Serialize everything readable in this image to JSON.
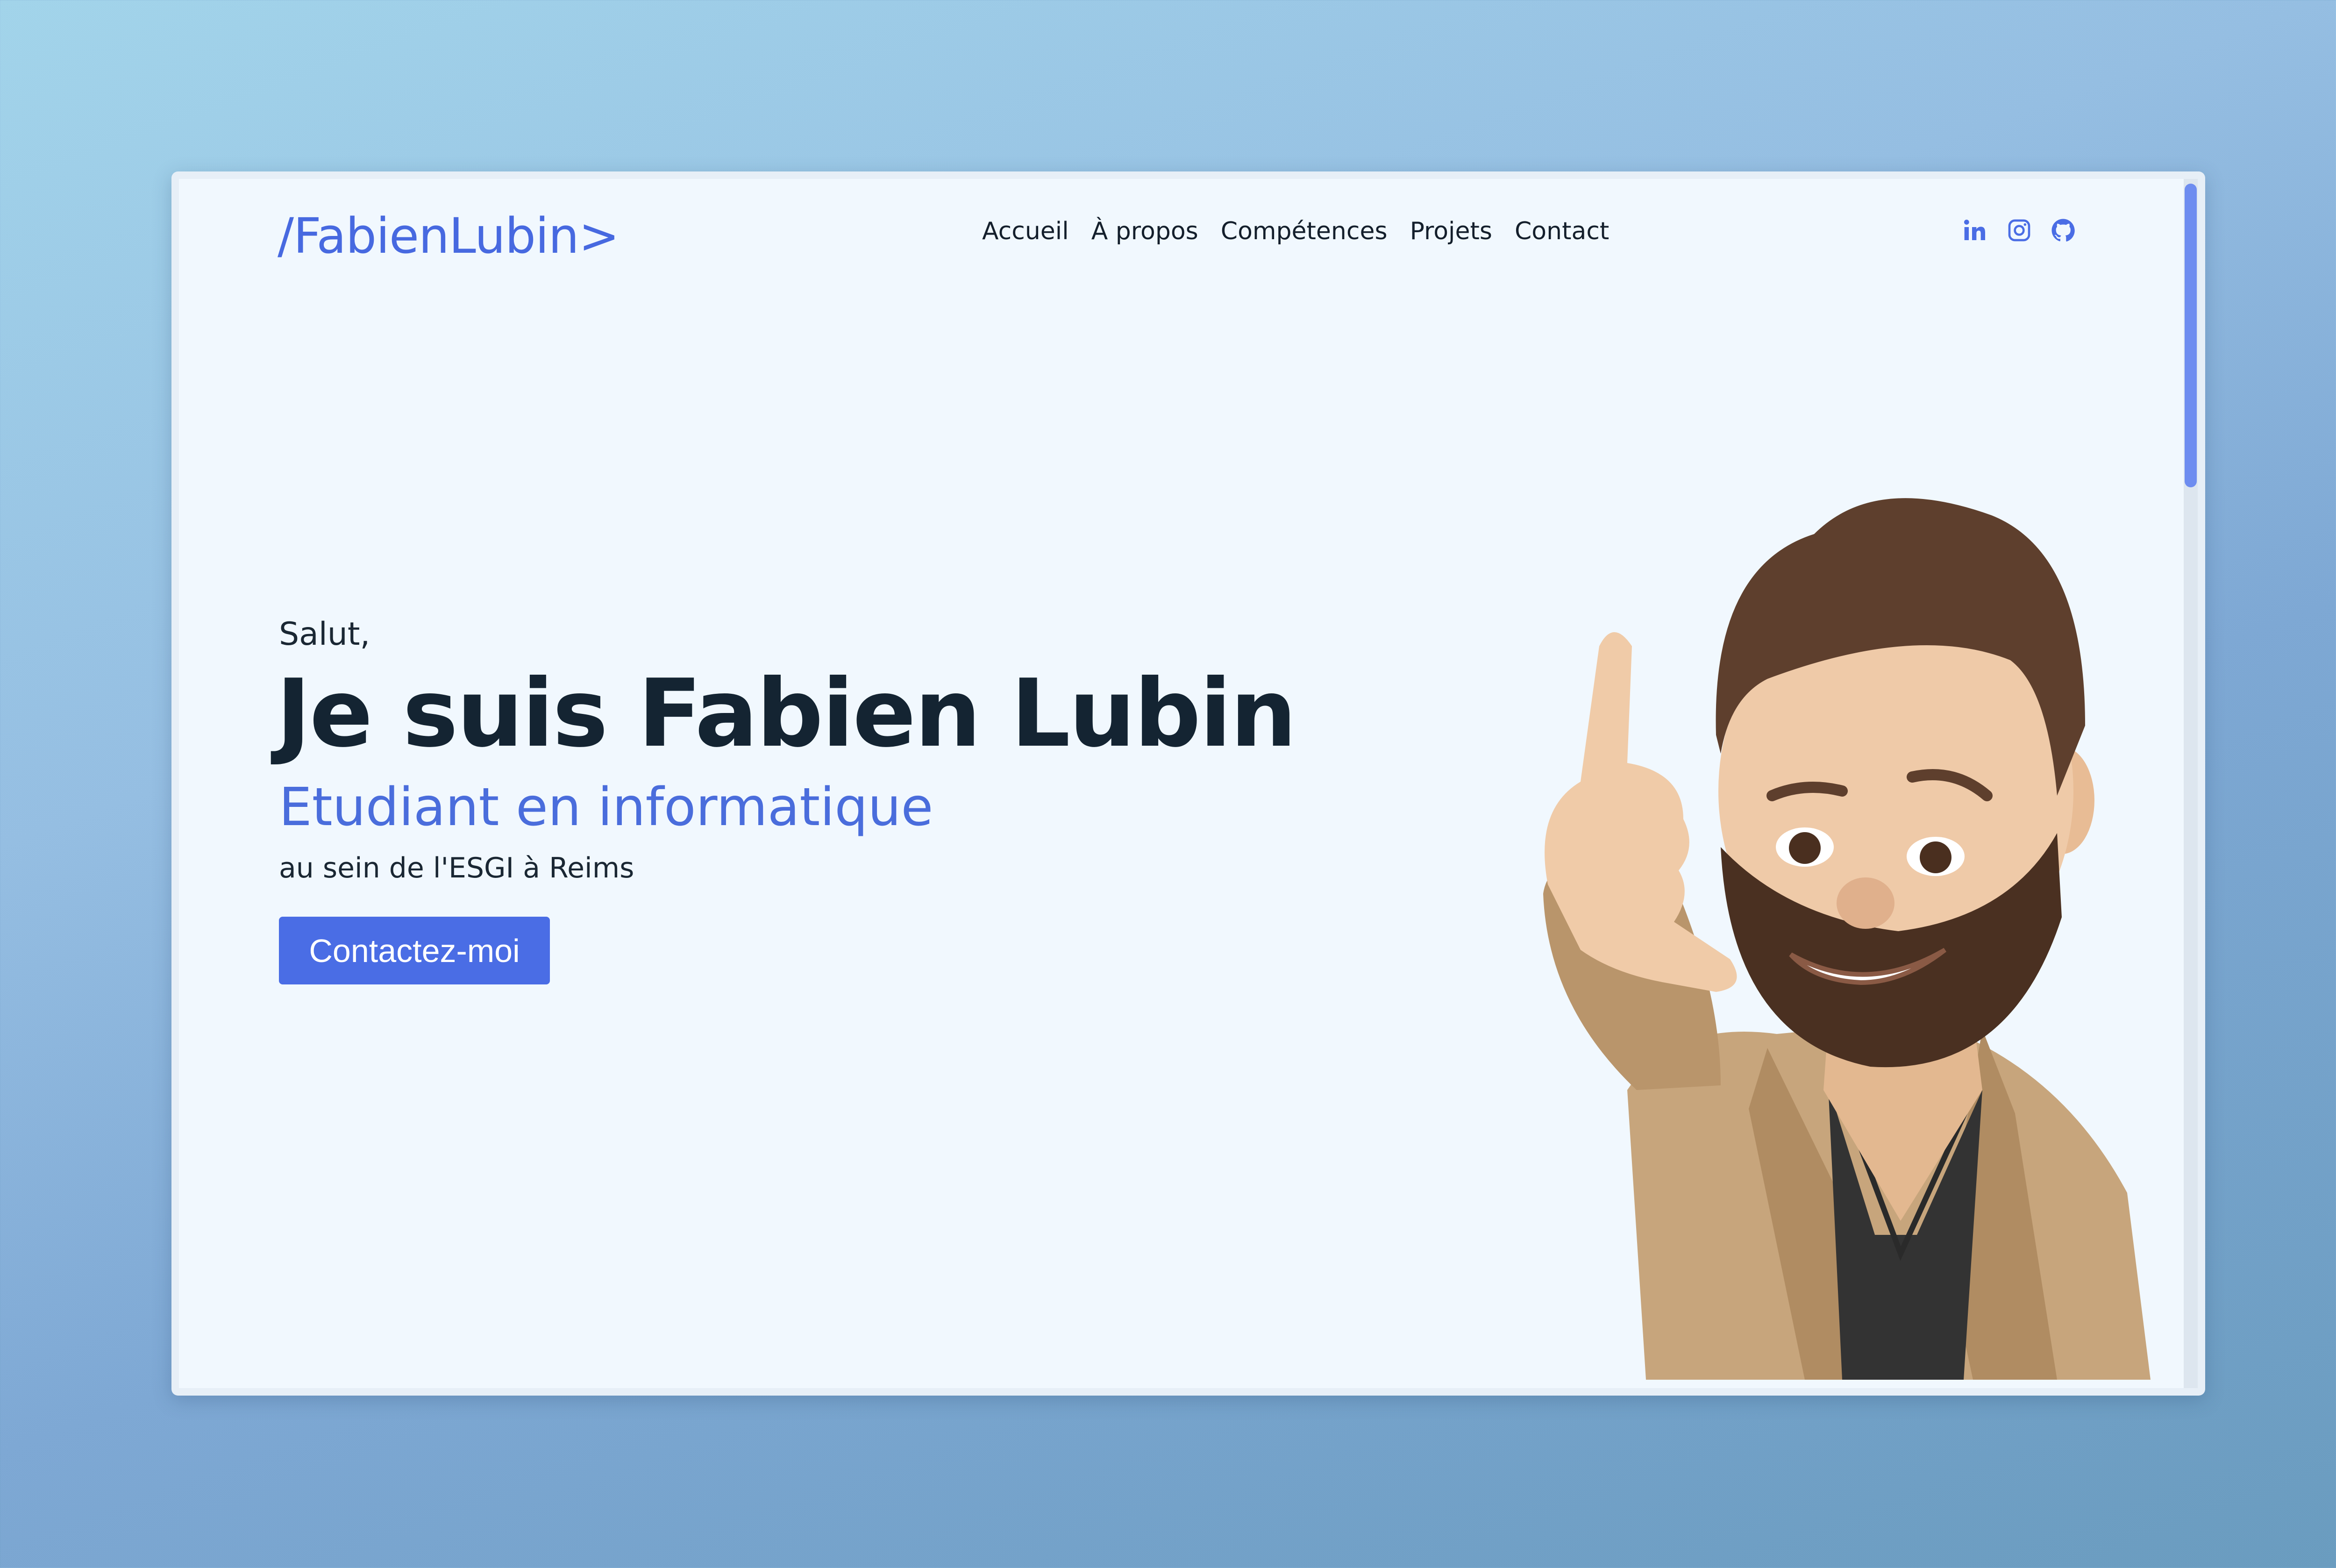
{
  "header": {
    "logo": "/FabienLubin>",
    "nav": [
      "Accueil",
      "À propos",
      "Compétences",
      "Projets",
      "Contact"
    ],
    "social_icons": [
      "linkedin-icon",
      "instagram-icon",
      "github-icon"
    ]
  },
  "hero": {
    "greeting": "Salut,",
    "headline": "Je suis Fabien Lubin",
    "subtitle": "Etudiant en informatique",
    "school": "au sein de l'ESGI à Reims",
    "cta_label": "Contactez-moi"
  },
  "colors": {
    "accent": "#4a6de5",
    "text": "#142432",
    "page_bg": "#f1f8fe"
  }
}
